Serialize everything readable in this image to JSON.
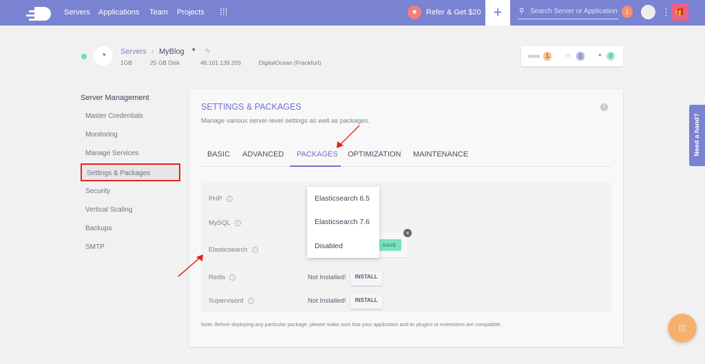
{
  "topbar": {
    "nav": [
      "Servers",
      "Applications",
      "Team",
      "Projects"
    ],
    "refer": "Refer & Get $20",
    "search_placeholder": "Search Server or Application",
    "notifications": "1"
  },
  "server": {
    "breadcrumb_root": "Servers",
    "name": "MyBlog",
    "size": "1GB",
    "disk": "25 GB Disk",
    "ip": "46.101.139.205",
    "provider": "DigitalOcean (Frankfurt)",
    "status_color": "#6fe0b0"
  },
  "stats": {
    "www_label": "www",
    "www": "1",
    "files": "1",
    "users": "0"
  },
  "sidebar": {
    "title": "Server Management",
    "items": [
      "Master Credentials",
      "Monitoring",
      "Manage Services",
      "Settings & Packages",
      "Security",
      "Vertical Scaling",
      "Backups",
      "SMTP"
    ],
    "active": "Settings & Packages"
  },
  "main": {
    "title": "SETTINGS & PACKAGES",
    "subtitle": "Manage various server-level settings as well as packages.",
    "tabs": [
      "BASIC",
      "ADVANCED",
      "PACKAGES",
      "OPTIMIZATION",
      "MAINTENANCE"
    ],
    "active_tab": "PACKAGES",
    "packages": [
      {
        "name": "PHP"
      },
      {
        "name": "MySQL"
      },
      {
        "name": "Elasticsearch",
        "action": "SAVE"
      },
      {
        "name": "Redis",
        "status": "Not Installed!",
        "action": "INSTALL"
      },
      {
        "name": "Supervisord",
        "status": "Not Installed!",
        "action": "INSTALL"
      }
    ],
    "dropdown": [
      "Elasticsearch 6.5",
      "Elasticsearch 7.6",
      "Disabled"
    ],
    "note": "Note: Before deploying any particular package, please make sure that your application and its plugins or extensions are compatible."
  },
  "help_tab": "Need a hand?"
}
